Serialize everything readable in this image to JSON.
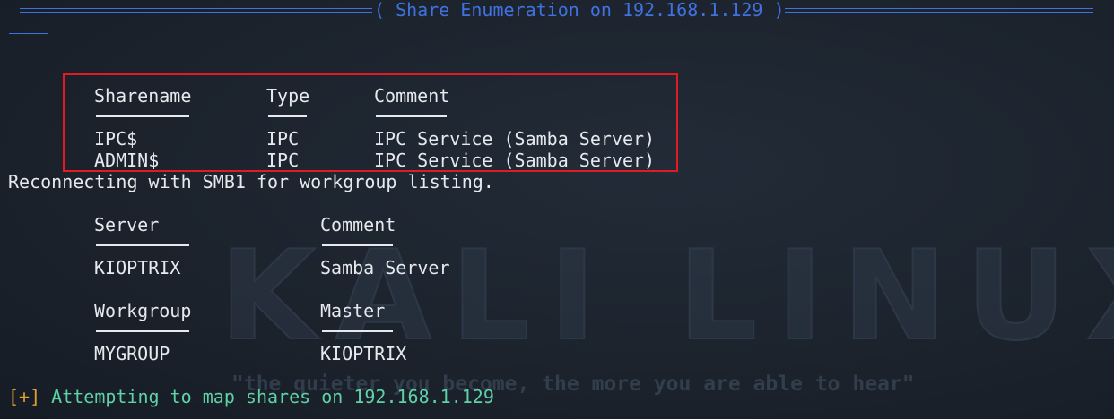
{
  "header": {
    "title": "( Share Enumeration on 192.168.1.129 )"
  },
  "shares": {
    "headers": [
      "Sharename",
      "Type",
      "Comment"
    ],
    "rows": [
      {
        "name": "IPC$",
        "type": "IPC",
        "comment": "IPC Service (Samba Server)"
      },
      {
        "name": "ADMIN$",
        "type": "IPC",
        "comment": "IPC Service (Samba Server)"
      }
    ]
  },
  "reconnect_msg": "Reconnecting with SMB1 for workgroup listing.",
  "servers": {
    "headers": [
      "Server",
      "Comment"
    ],
    "rows": [
      {
        "server": "KIOPTRIX",
        "comment": "Samba Server"
      }
    ]
  },
  "workgroups": {
    "headers": [
      "Workgroup",
      "Master"
    ],
    "rows": [
      {
        "workgroup": "MYGROUP",
        "master": "KIOPTRIX"
      }
    ]
  },
  "status": {
    "marker": "[+]",
    "text": "Attempting to map shares on 192.168.1.129"
  },
  "watermark": {
    "logo_text": "KALI LINUX",
    "tagline": "\"the quieter you become, the more you are able to hear\""
  },
  "colors": {
    "background": "#1b222c",
    "accent_blue": "#3f72e0",
    "highlight_red": "#e21a22",
    "status_green": "#5fd1a6",
    "status_orange": "#e0a133",
    "text": "#e6e9ee"
  }
}
